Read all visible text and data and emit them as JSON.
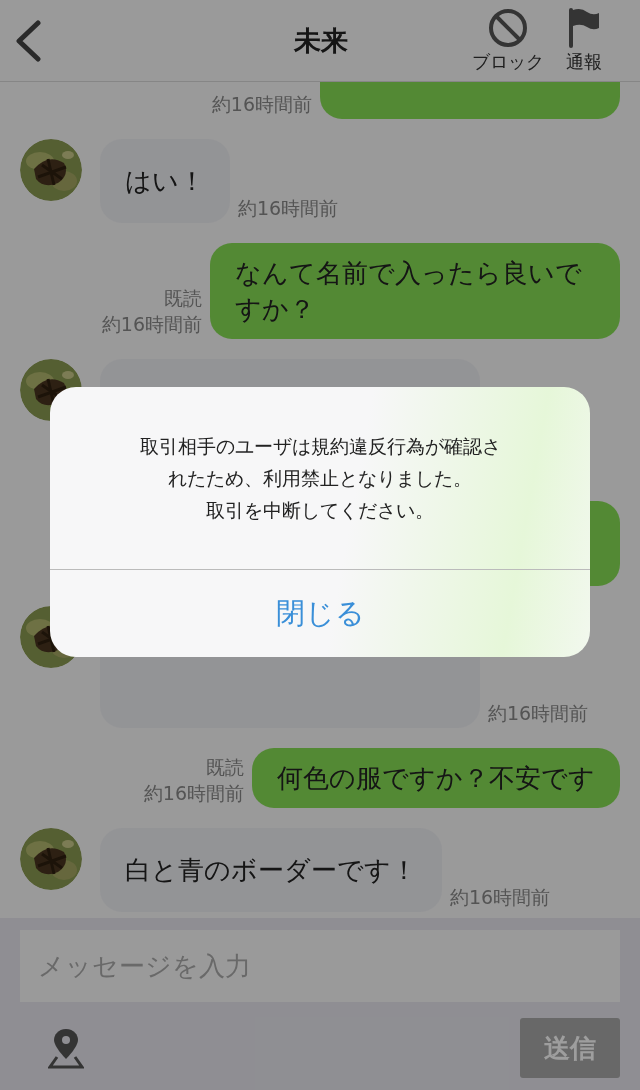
{
  "header": {
    "title": "未来",
    "actions": [
      {
        "kind": "block",
        "label": "ブロック"
      },
      {
        "kind": "report",
        "label": "通報"
      }
    ]
  },
  "messages": [
    {
      "kind": "outgoing",
      "time": "約16時間前"
    },
    {
      "kind": "incoming",
      "text": "はい！",
      "time": "約16時間前"
    },
    {
      "kind": "outgoing",
      "text": "なんて名前で入ったら良いですか？",
      "read_label": "既読",
      "time": "約16時間前"
    },
    {
      "kind": "incoming"
    },
    {
      "kind": "outgoing"
    },
    {
      "kind": "incoming",
      "time": "約16時間前"
    },
    {
      "kind": "outgoing",
      "text": "何色の服ですか？不安です",
      "read_label": "既読",
      "time": "約16時間前"
    },
    {
      "kind": "incoming",
      "text": "白と青のボーダーです！",
      "time": "約16時間前"
    }
  ],
  "composer": {
    "placeholder": "メッセージを入力",
    "send": "送信"
  },
  "dialog": {
    "message_lines": [
      "取引相手のユーザは規約違反行為が確認されたため、利用禁止となりました。",
      "取引を中断してください。"
    ],
    "button": "閉じる"
  }
}
